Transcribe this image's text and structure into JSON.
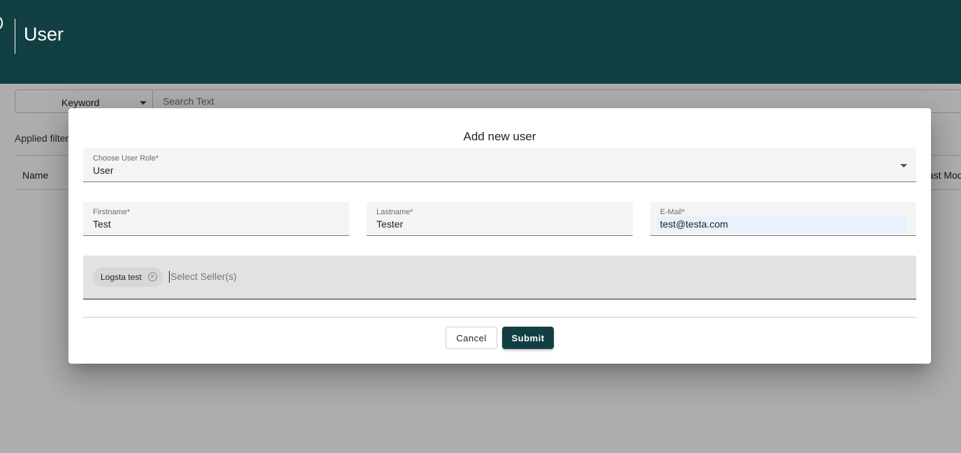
{
  "header": {
    "title": "User"
  },
  "search": {
    "type_label": "Keyword",
    "placeholder": "Search Text"
  },
  "filters": {
    "applied_label": "Applied filter"
  },
  "table": {
    "columns": [
      "Name",
      "Last Mod"
    ]
  },
  "dialog": {
    "title": "Add new user",
    "role": {
      "label": "Choose User Role*",
      "value": "User"
    },
    "firstname": {
      "label": "Firstname*",
      "value": "Test"
    },
    "lastname": {
      "label": "Lastname*",
      "value": "Tester"
    },
    "email": {
      "label": "E-Mail*",
      "value": "test@testa.com"
    },
    "sellers": {
      "chips": [
        "Logsta test"
      ],
      "placeholder": "Select Seller(s)"
    },
    "cancel_label": "Cancel",
    "submit_label": "Submit"
  },
  "colors": {
    "brand": "#123f42",
    "autofill": "#e8f0fe"
  }
}
